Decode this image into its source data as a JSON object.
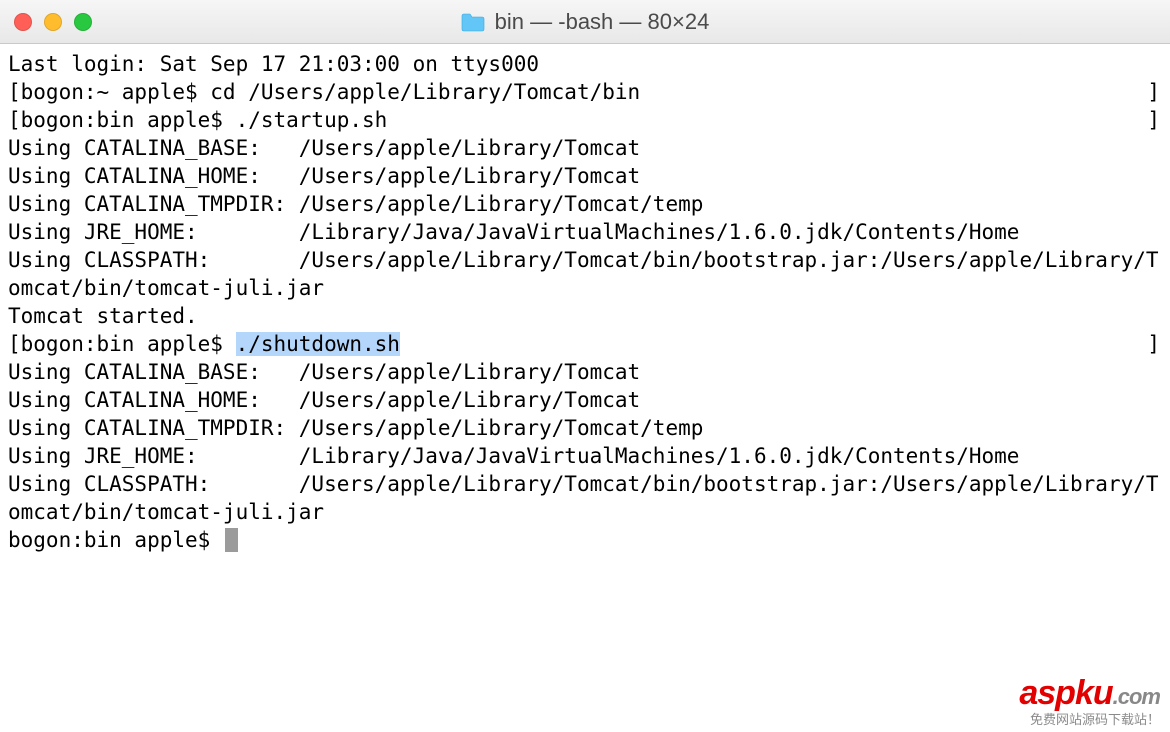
{
  "window": {
    "title": "bin — -bash — 80×24"
  },
  "terminal": {
    "lines": [
      {
        "text": "Last login: Sat Sep 17 21:03:00 on ttys000"
      },
      {
        "text": "[bogon:~ apple$ cd /Users/apple/Library/Tomcat/bin",
        "rightBracket": true
      },
      {
        "text": "[bogon:bin apple$ ./startup.sh",
        "rightBracket": true
      },
      {
        "text": "Using CATALINA_BASE:   /Users/apple/Library/Tomcat"
      },
      {
        "text": "Using CATALINA_HOME:   /Users/apple/Library/Tomcat"
      },
      {
        "text": "Using CATALINA_TMPDIR: /Users/apple/Library/Tomcat/temp"
      },
      {
        "text": "Using JRE_HOME:        /Library/Java/JavaVirtualMachines/1.6.0.jdk/Contents/Home"
      },
      {
        "text": "Using CLASSPATH:       /Users/apple/Library/Tomcat/bin/bootstrap.jar:/Users/apple/Library/Tomcat/bin/tomcat-juli.jar"
      },
      {
        "text": "Tomcat started."
      },
      {
        "prefix": "[bogon:bin apple$ ",
        "highlight": "./shutdown.sh",
        "rightBracket": true
      },
      {
        "text": "Using CATALINA_BASE:   /Users/apple/Library/Tomcat"
      },
      {
        "text": "Using CATALINA_HOME:   /Users/apple/Library/Tomcat"
      },
      {
        "text": "Using CATALINA_TMPDIR: /Users/apple/Library/Tomcat/temp"
      },
      {
        "text": "Using JRE_HOME:        /Library/Java/JavaVirtualMachines/1.6.0.jdk/Contents/Home"
      },
      {
        "text": "Using CLASSPATH:       /Users/apple/Library/Tomcat/bin/bootstrap.jar:/Users/apple/Library/Tomcat/bin/tomcat-juli.jar"
      },
      {
        "prompt": "bogon:bin apple$ ",
        "cursor": true
      }
    ]
  },
  "watermark": {
    "brand_prefix": "asp",
    "brand_mid": "ku",
    "brand_suffix": ".com",
    "tagline": "免费网站源码下载站！"
  }
}
